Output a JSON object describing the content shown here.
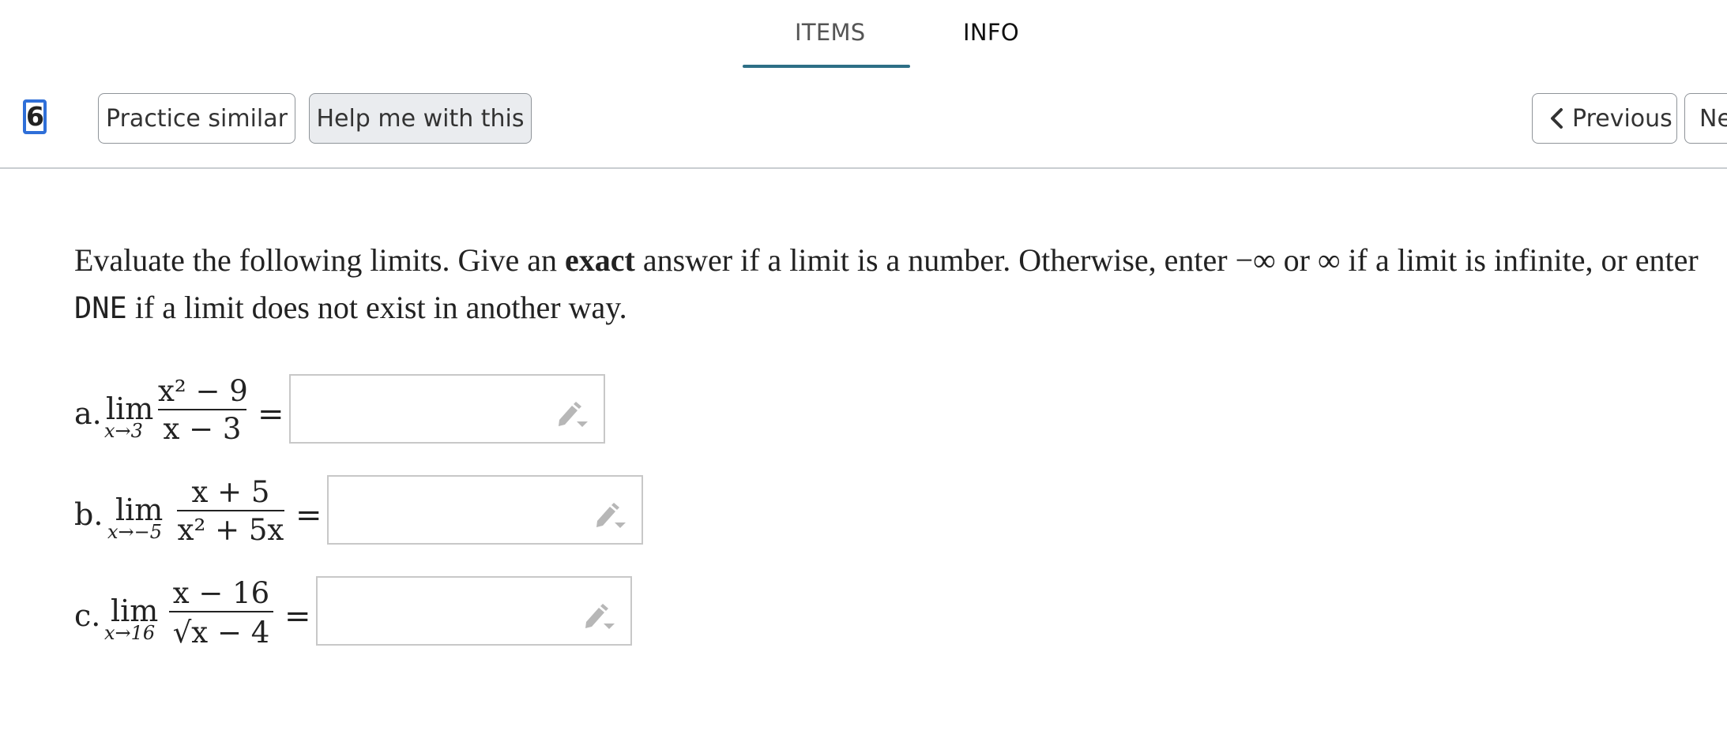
{
  "tabs": {
    "items": "ITEMS",
    "info": "INFO"
  },
  "toolbar": {
    "question_number": "6.",
    "practice_label": "Practice similar",
    "help_label": "Help me with this",
    "previous_label": "Previous",
    "next_label": "Ne"
  },
  "prompt": {
    "part1": "Evaluate the following limits. Give an ",
    "bold": "exact",
    "part2": " answer if a limit is a number. Otherwise, enter −∞ or ∞ if a limit is infinite, or enter ",
    "mono": "DNE",
    "part3": " if a limit does not exist in another way."
  },
  "problems": [
    {
      "label": "a.",
      "lim": "lim",
      "sub": "x→3",
      "numerator": "x² − 9",
      "denominator": "x − 3",
      "eq": "=",
      "value": ""
    },
    {
      "label": "b.",
      "lim": "lim",
      "sub": "x→−5",
      "numerator": "x + 5",
      "denominator": "x² + 5x",
      "eq": "=",
      "value": ""
    },
    {
      "label": "c.",
      "lim": "lim",
      "sub": "x→16",
      "numerator": "x − 16",
      "denominator": "√x − 4",
      "eq": "=",
      "value": ""
    }
  ],
  "icons": {
    "answer_tool": "pencil-dropdown-icon",
    "prev": "chevron-left-icon"
  },
  "colors": {
    "tab_underline": "#2d6f86",
    "focus_outline": "#2f6fd8"
  }
}
